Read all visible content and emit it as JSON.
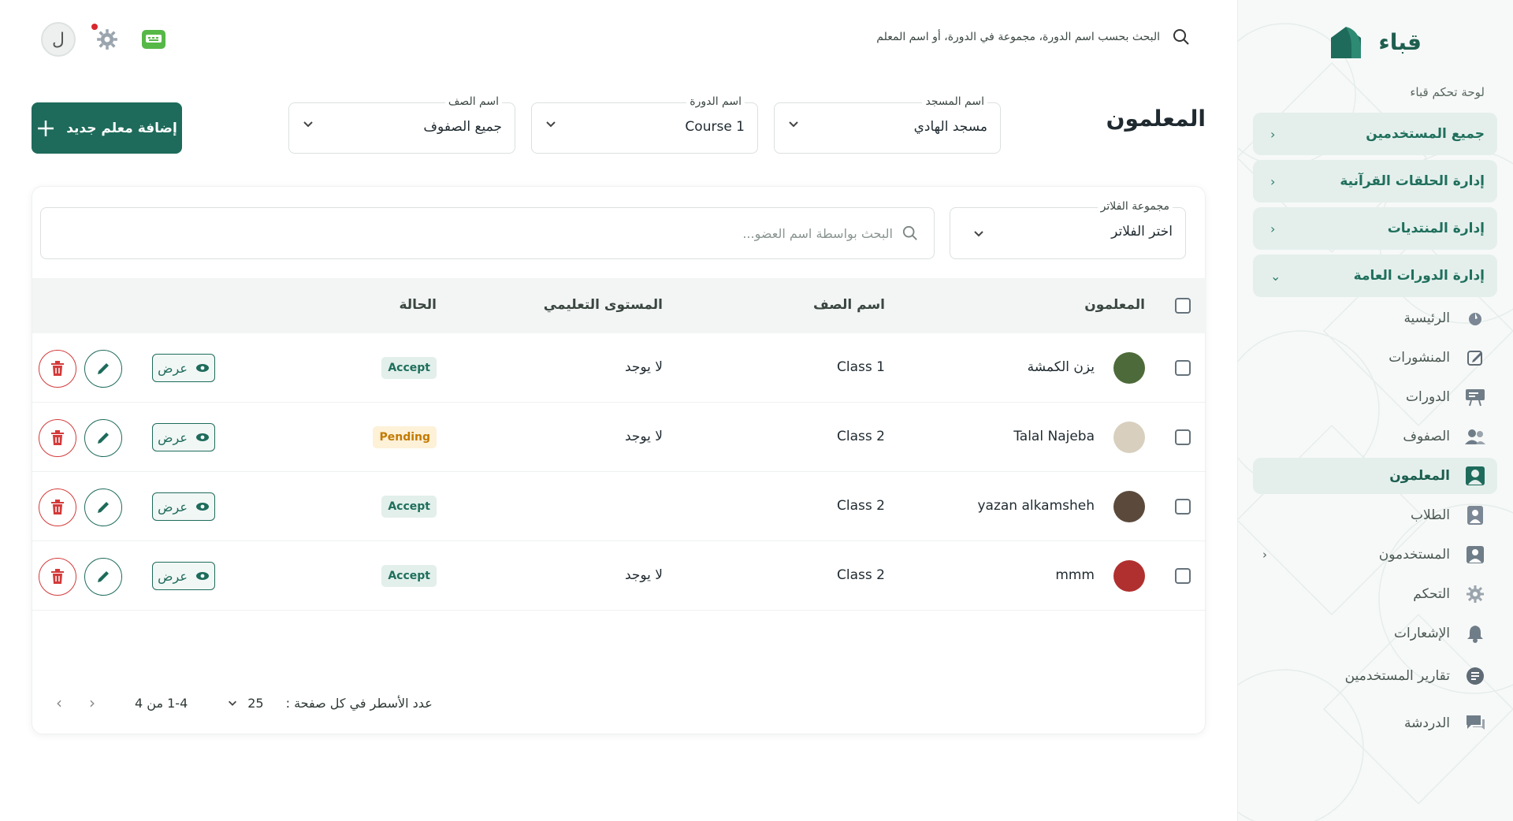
{
  "sidebar": {
    "brand": "قباء",
    "section_label": "لوحة تحكم قباء",
    "groups": [
      {
        "label": "جميع المستخدمين"
      },
      {
        "label": "إدارة الحلقات القرآنية"
      },
      {
        "label": "إدارة المنتديات"
      },
      {
        "label": "إدارة الدورات العامة"
      }
    ],
    "items": [
      {
        "label": "الرئيسية",
        "icon": "home-icon"
      },
      {
        "label": "المنشورات",
        "icon": "edit-icon"
      },
      {
        "label": "الدورات",
        "icon": "presentation-icon"
      },
      {
        "label": "الصفوف",
        "icon": "users-icon"
      },
      {
        "label": "المعلمون",
        "icon": "teacher-icon"
      },
      {
        "label": "الطلاب",
        "icon": "student-icon"
      },
      {
        "label": "المستخدمون",
        "icon": "user-icon"
      },
      {
        "label": "التحكم",
        "icon": "gear-icon"
      },
      {
        "label": "الإشعارات",
        "icon": "bell-icon"
      },
      {
        "label": "تقارير المستخدمين",
        "icon": "report-icon"
      },
      {
        "label": "الدردشة",
        "icon": "chat-icon"
      }
    ]
  },
  "topbar": {
    "search_text": "البحث بحسب اسم الدورة، مجموعة في الدورة، أو اسم المعلم",
    "avatar_letter": "ل"
  },
  "header": {
    "title": "المعلمون",
    "mosque": {
      "label": "اسم المسجد",
      "value": "مسجد الهادي"
    },
    "course": {
      "label": "اسم الدورة",
      "value": "Course 1"
    },
    "class": {
      "label": "اسم الصف",
      "value": "جميع الصفوف"
    },
    "add_button": "إضافة معلم جديد"
  },
  "filters": {
    "group_label": "مجموعة الفلاتر",
    "group_value": "اختر الفلاتر",
    "search_placeholder": "البحث بواسطة اسم العضو..."
  },
  "table": {
    "columns": {
      "teacher": "المعلمون",
      "class": "اسم الصف",
      "level": "المستوى التعليمي",
      "status": "الحالة"
    },
    "view_label": "عرض",
    "rows": [
      {
        "name": "يزن الكمشة",
        "class": "Class 1",
        "level": "لا يوجد",
        "status": "Accept",
        "avatar_color": "#4d6b3a"
      },
      {
        "name": "Talal Najeba",
        "class": "Class 2",
        "level": "لا يوجد",
        "status": "Pending",
        "avatar_color": "#d8cfbf"
      },
      {
        "name": "yazan alkamsheh",
        "class": "Class 2",
        "level": "",
        "status": "Accept",
        "avatar_color": "#5b4a3c"
      },
      {
        "name": "mmm",
        "class": "Class 2",
        "level": "لا يوجد",
        "status": "Accept",
        "avatar_color": "#b0302f"
      }
    ]
  },
  "pagination": {
    "rows_per_page_label": "عدد الأسطر في كل صفحة :",
    "rows_per_page": "25",
    "range": "1-4 من 4"
  },
  "colors": {
    "primary": "#1e6b5b",
    "danger": "#d43a3a",
    "accept_bg": "#e2efeb",
    "pending_bg": "#fdf1d8"
  }
}
